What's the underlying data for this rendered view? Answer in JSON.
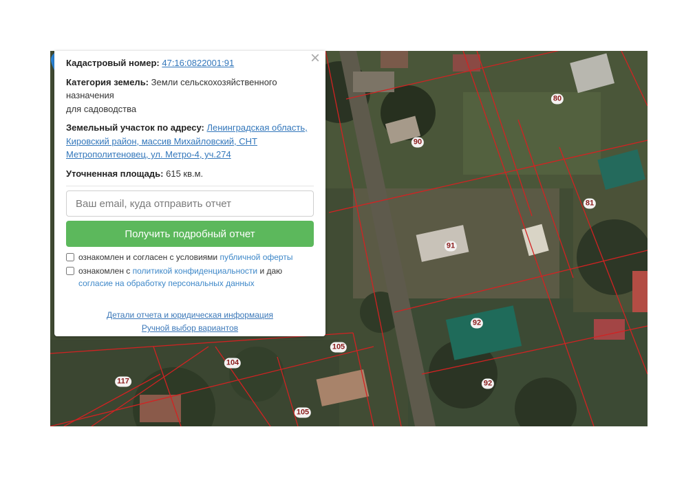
{
  "panel": {
    "close_symbol": "×",
    "cadastral_label": "Кадастровый номер:",
    "cadastral_value": "47:16:0822001:91",
    "category_label": "Категория земель:",
    "category_value_line1": "Земли сельскохозяйственного назначения",
    "category_value_line2": "для садоводства",
    "address_label": "Земельный участок по адресу:",
    "address_value": "Ленинградская область, Кировский район, массив Михайловский, СНТ Метрополитеновец, ул. Метро-4, уч.274",
    "area_label": "Уточненная площадь:",
    "area_value": "615 кв.м.",
    "email_placeholder": "Ваш email, куда отправить отчет",
    "email_value": "",
    "report_button": "Получить подробный отчет",
    "consent1_text": "ознакомлен и согласен с условиями",
    "consent1_link": "публичной оферты",
    "consent2_text_a": "ознакомлен с",
    "consent2_link_a": "политикой конфиденциальности",
    "consent2_text_b": "и даю",
    "consent2_link_b": "согласие на обработку персональных данных",
    "details_link": "Детали отчета и юридическая информация",
    "manual_link": "Ручной выбор вариантов"
  },
  "map": {
    "plot_labels": [
      "80",
      "90",
      "81",
      "91",
      "92",
      "92",
      "105",
      "104",
      "117",
      "105"
    ],
    "boundary_color": "#d32222",
    "pin_color": "#2b86db",
    "pin_icon": "map-marker-icon"
  }
}
